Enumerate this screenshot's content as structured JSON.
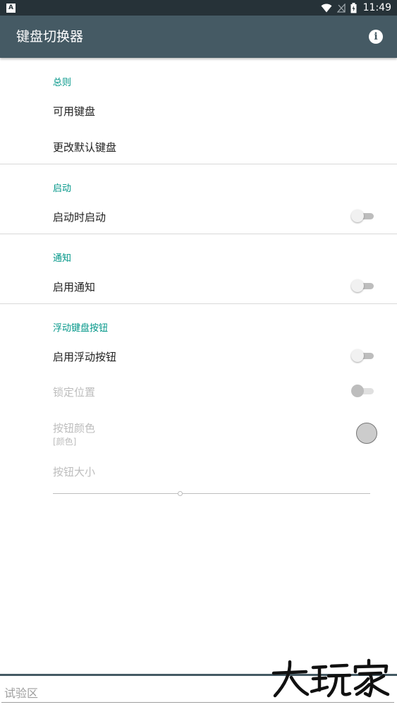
{
  "status_bar": {
    "left_icon": "A",
    "icons": [
      "wifi-icon",
      "signal-off-icon",
      "battery-charging-icon"
    ],
    "time": "11:49"
  },
  "app_bar": {
    "title": "键盘切换器",
    "info_icon": "i"
  },
  "sections": {
    "general": {
      "header": "总则",
      "available_keyboards": "可用键盘",
      "change_default_keyboard": "更改默认键盘"
    },
    "startup": {
      "header": "启动",
      "start_on_boot": {
        "label": "启动时启动",
        "checked": false
      }
    },
    "notification": {
      "header": "通知",
      "enable_notification": {
        "label": "启用通知",
        "checked": false
      }
    },
    "floating_button": {
      "header": "浮动键盘按钮",
      "enable_floating_button": {
        "label": "启用浮动按钮",
        "checked": false
      },
      "lock_position": {
        "label": "锁定位置",
        "checked": false,
        "enabled": false
      },
      "button_color": {
        "label": "按钮颜色",
        "summary": "[颜色]",
        "swatch": "#cccccc"
      },
      "button_size": {
        "label": "按钮大小",
        "value_fraction": 0.4
      }
    }
  },
  "test_area": {
    "placeholder": "试验区",
    "value": ""
  },
  "watermark": {
    "text": "大玩家"
  },
  "colors": {
    "status_bar": "#263238",
    "app_bar": "#455a64",
    "accent": "#009688"
  }
}
